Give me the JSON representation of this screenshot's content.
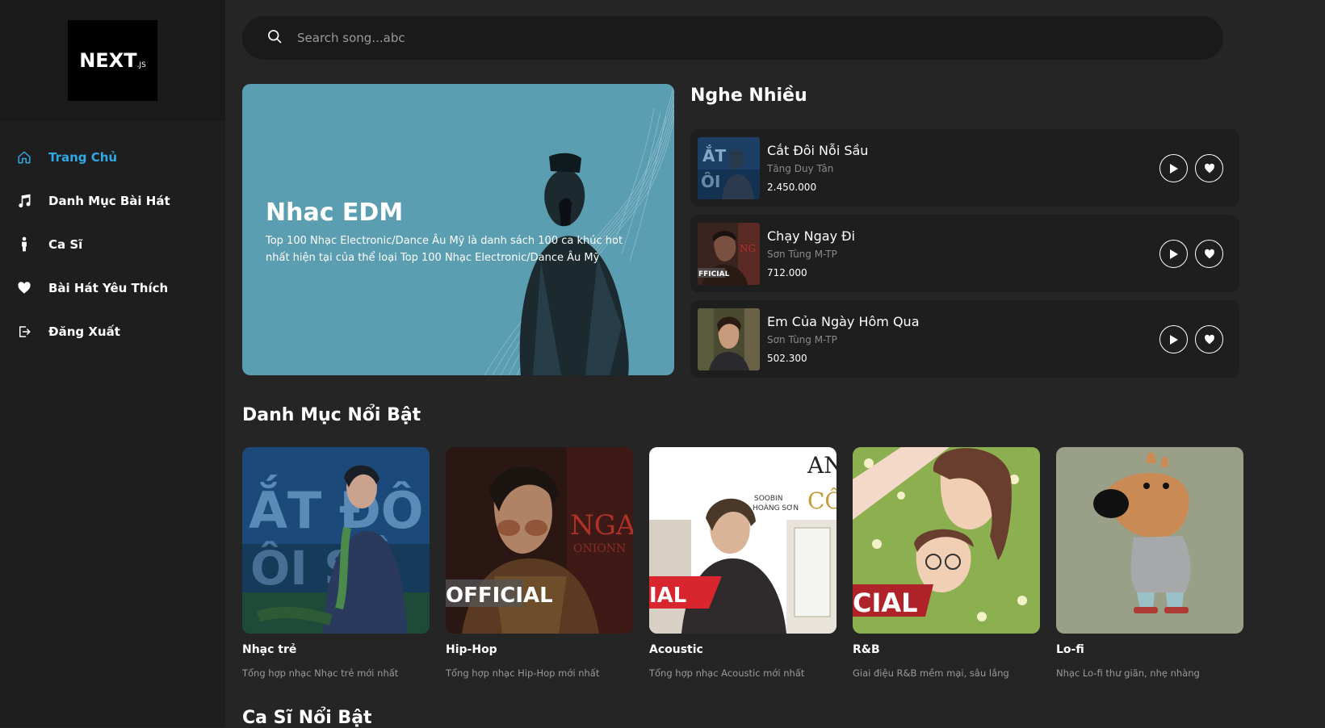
{
  "logo": {
    "main": "NEXT",
    "sub": ".JS"
  },
  "sidebar": {
    "items": [
      {
        "label": "Trang Chủ",
        "icon": "home-icon",
        "active": true
      },
      {
        "label": "Danh Mục Bài Hát",
        "icon": "music-note-icon"
      },
      {
        "label": "Ca Sĩ",
        "icon": "person-icon"
      },
      {
        "label": "Bài Hát Yêu Thích",
        "icon": "heart-icon"
      },
      {
        "label": "Đăng Xuất",
        "icon": "logout-icon"
      }
    ]
  },
  "search": {
    "placeholder": "Search song...abc",
    "icon": "search-icon"
  },
  "hero": {
    "title": "Nhac EDM",
    "description": "Top 100 Nhạc Electronic/Dance Âu Mỹ là danh sách 100 ca khúc hot nhất hiện tại của thể loại Top 100 Nhạc Electronic/Dance Âu Mỹ"
  },
  "top_songs": {
    "title": "Nghe Nhiều",
    "items": [
      {
        "title": "Cắt Đôi Nỗi Sầu",
        "artist": "Tăng Duy Tân",
        "plays": "2.450.000"
      },
      {
        "title": "Chạy Ngay Đi",
        "artist": "Sơn Tùng M-TP",
        "plays": "712.000"
      },
      {
        "title": "Em Của Ngày Hôm Qua",
        "artist": "Sơn Tùng M-TP",
        "plays": "502.300"
      }
    ]
  },
  "categories": {
    "title": "Danh Mục Nổi Bật",
    "items": [
      {
        "name": "Nhạc trẻ",
        "desc": "Tổng hợp nhạc Nhạc trẻ mới nhất"
      },
      {
        "name": "Hip-Hop",
        "desc": "Tổng hợp nhạc Hip-Hop mới nhất"
      },
      {
        "name": "Acoustic",
        "desc": "Tổng hợp nhạc Acoustic mới nhất"
      },
      {
        "name": "R&B",
        "desc": "Giai điệu R&B mềm mại, sâu lắng"
      },
      {
        "name": "Lo-fi",
        "desc": "Nhạc Lo-fi thư giãn, nhẹ nhàng"
      }
    ]
  },
  "artists": {
    "title": "Ca Sĩ Nổi Bật"
  },
  "colors": {
    "accent": "#2fa8e3",
    "sidebar_bg": "#1e1e1e",
    "main_bg": "#252525",
    "hero_bg": "#5b9db1"
  }
}
